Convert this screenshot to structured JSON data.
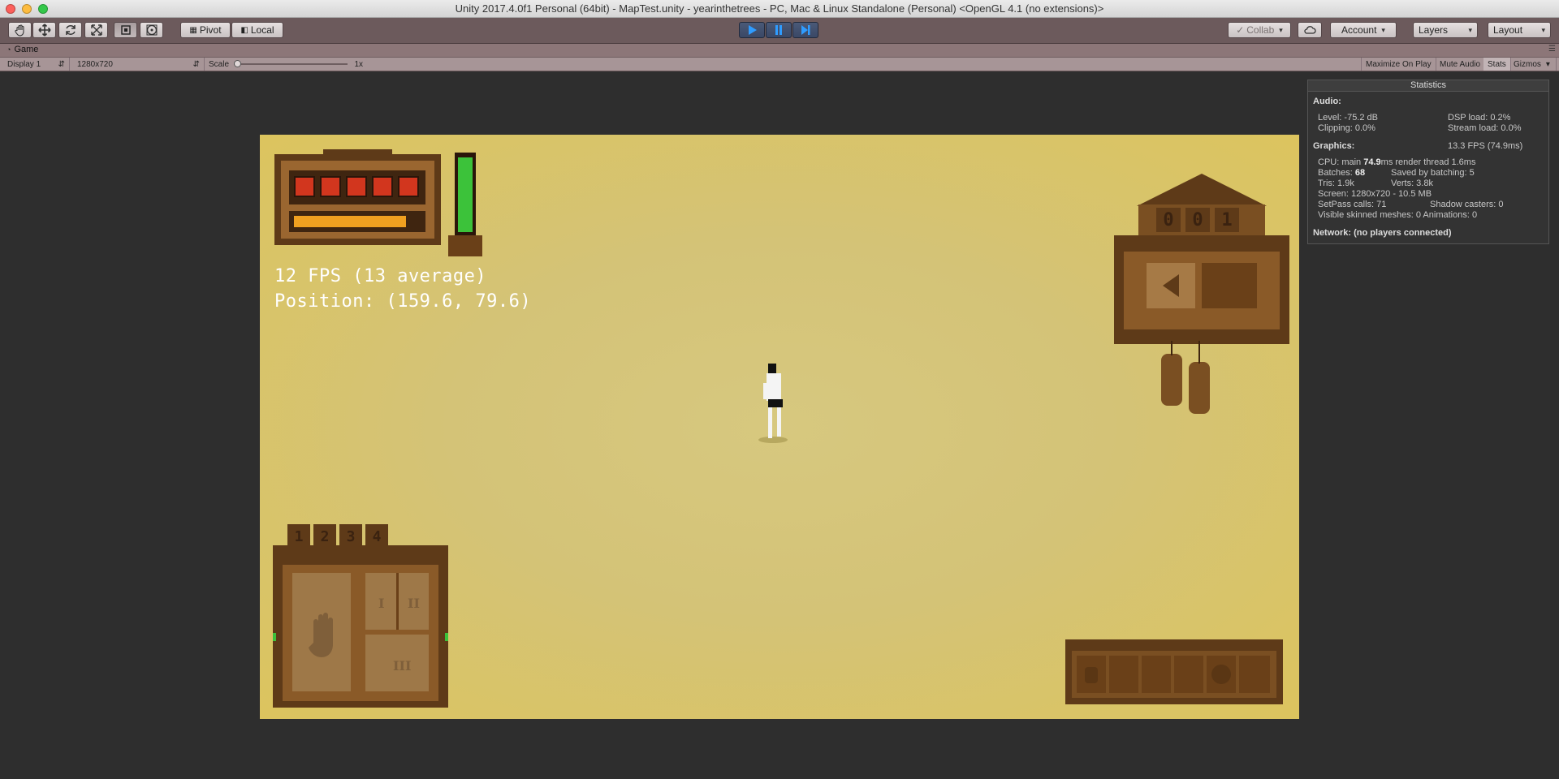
{
  "window": {
    "title": "Unity 2017.4.0f1 Personal (64bit) - MapTest.unity - yearinthetrees - PC, Mac & Linux Standalone (Personal) <OpenGL 4.1 (no extensions)>"
  },
  "toolbar": {
    "pivot_label": "Pivot",
    "local_label": "Local",
    "collab_label": "Collab",
    "account_label": "Account",
    "layers_label": "Layers",
    "layout_label": "Layout"
  },
  "game_tab": {
    "label": "Game",
    "display": "Display 1",
    "resolution": "1280x720",
    "scale_label": "Scale",
    "scale_value": "1x",
    "scale_level": 0.0,
    "maximize_label": "Maximize On Play",
    "mute_label": "Mute Audio",
    "stats_label": "Stats",
    "gizmos_label": "Gizmos"
  },
  "hud": {
    "fps_text": "12 FPS (13 average)",
    "position_text": "Position: (159.6, 79.6)",
    "counter_digits": [
      "0",
      "0",
      "1"
    ],
    "slot_numbers": [
      "1",
      "2",
      "3",
      "4"
    ],
    "roman_1": "I",
    "roman_2": "II",
    "roman_3": "III"
  },
  "stats": {
    "title": "Statistics",
    "audio_label": "Audio:",
    "level": "Level: -75.2 dB",
    "dsp": "DSP load: 0.2%",
    "clipping": "Clipping: 0.0%",
    "stream": "Stream load: 0.0%",
    "graphics_label": "Graphics:",
    "fps": "13.3 FPS (74.9ms)",
    "cpu_prefix": "CPU: main ",
    "cpu_main": "74.9",
    "cpu_suffix": "ms  render thread 1.6ms",
    "batches_prefix": "Batches: ",
    "batches": "68",
    "saved_batching": "Saved by batching: 5",
    "tris": "Tris: 1.9k",
    "verts": "Verts: 3.8k",
    "screen": "Screen: 1280x720 - 10.5 MB",
    "setpass": "SetPass calls: 71",
    "shadow": "Shadow casters: 0",
    "skinned": "Visible skinned meshes: 0  Animations: 0",
    "network": "Network: (no players connected)"
  },
  "colors": {
    "toolbar": "#6c5a5c",
    "game_bg": "#d4c377",
    "wood": "#7a4f22",
    "health_green": "#3cc23a",
    "gem_red": "#d2361e",
    "bar_orange": "#f0a020"
  }
}
